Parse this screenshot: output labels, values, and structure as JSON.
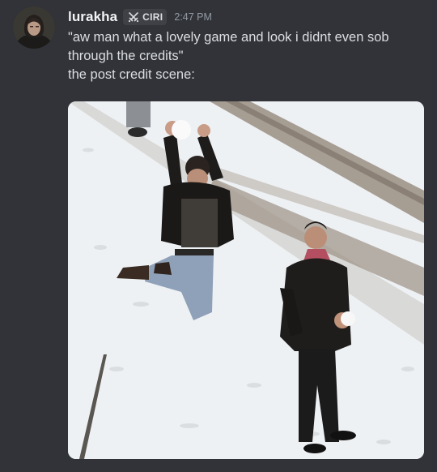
{
  "message": {
    "username": "lurakha",
    "server_tag": "CIRI",
    "timestamp": "2:47 PM",
    "content_lines": [
      "\"aw man what a lovely game and look i didnt even sob",
      "through the credits\"",
      "the post credit scene:"
    ]
  },
  "icons": {
    "server_tag_icon": "crossed-swords-icon"
  },
  "colors": {
    "background": "#313338",
    "username": "#f2f3f5",
    "message_text": "#dbdee1",
    "timestamp": "#949ba4",
    "tag_background": "#3f4147"
  }
}
